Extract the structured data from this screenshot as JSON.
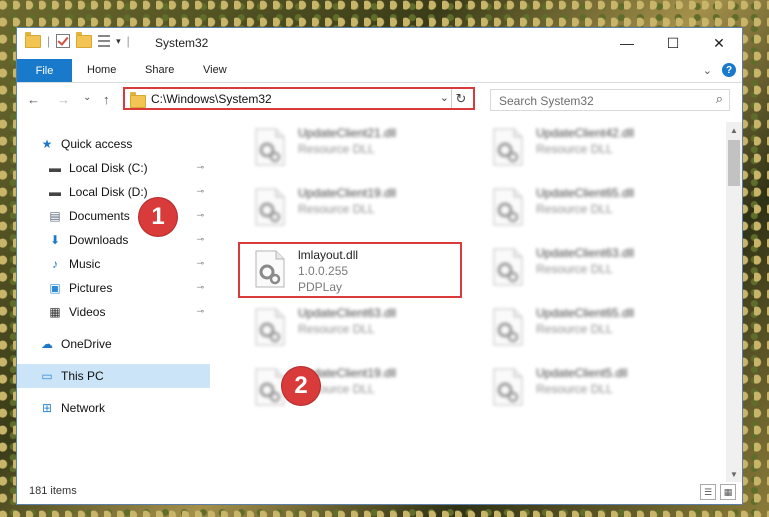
{
  "window": {
    "title": "System32",
    "caption_buttons": {
      "minimize": "—",
      "maximize": "☐",
      "close": "✕"
    }
  },
  "ribbon": {
    "file_tab": "File",
    "tabs": [
      "Home",
      "Share",
      "View"
    ],
    "expand_glyph": "⌄",
    "help_glyph": "?"
  },
  "navigation": {
    "back_glyph": "←",
    "forward_glyph": "→",
    "recent_glyph": "⌄",
    "up_glyph": "↑",
    "address": "C:\\Windows\\System32",
    "address_caret": "⌄",
    "refresh_glyph": "↻",
    "search_placeholder": "Search System32",
    "search_glyph": "⌕"
  },
  "sidebar": {
    "items": [
      {
        "label": "Quick access",
        "icon": "star-icon",
        "glyph": "★",
        "color": "#1e78c8",
        "pinned": false
      },
      {
        "label": "Local Disk (C:)",
        "icon": "drive-icon",
        "glyph": "▬",
        "color": "#444444",
        "pinned": true
      },
      {
        "label": "Local Disk (D:)",
        "icon": "drive-icon",
        "glyph": "▬",
        "color": "#444444",
        "pinned": true
      },
      {
        "label": "Documents",
        "icon": "document-icon",
        "glyph": "▤",
        "color": "#5a6b80",
        "pinned": true
      },
      {
        "label": "Downloads",
        "icon": "download-icon",
        "glyph": "⬇",
        "color": "#1e78c8",
        "pinned": true
      },
      {
        "label": "Music",
        "icon": "music-icon",
        "glyph": "♪",
        "color": "#1e78c8",
        "pinned": true
      },
      {
        "label": "Pictures",
        "icon": "pictures-icon",
        "glyph": "▣",
        "color": "#2e8bd8",
        "pinned": true
      },
      {
        "label": "Videos",
        "icon": "video-icon",
        "glyph": "▦",
        "color": "#333333",
        "pinned": true
      },
      {
        "label": "OneDrive",
        "icon": "cloud-icon",
        "glyph": "☁",
        "color": "#1e78c8",
        "pinned": false
      },
      {
        "label": "This PC",
        "icon": "computer-icon",
        "glyph": "▭",
        "color": "#2e8bd8",
        "pinned": false,
        "selected": true
      },
      {
        "label": "Network",
        "icon": "network-icon",
        "glyph": "⊞",
        "color": "#2e8bd8",
        "pinned": false
      }
    ],
    "pin_glyph": "📌"
  },
  "files": [
    {
      "name": "UpdateClient21.dll",
      "desc": "Resource DLL",
      "blurred": true
    },
    {
      "name": "UpdateClient42.dll",
      "desc": "Resource DLL",
      "blurred": true
    },
    {
      "name": "UpdateClient19.dll",
      "desc": "Resource DLL",
      "blurred": true
    },
    {
      "name": "UpdateClient65.dll",
      "desc": "Resource DLL",
      "blurred": true
    },
    {
      "name": "lmlayout.dll",
      "desc": "1.0.0.255",
      "desc2": "PDPLay",
      "blurred": false,
      "highlighted": true
    },
    {
      "name": "UpdateClient63.dll",
      "desc": "Resource DLL",
      "blurred": true
    },
    {
      "name": "UpdateClient63.dll",
      "desc": "Resource DLL",
      "blurred": true
    },
    {
      "name": "UpdateClient65.dll",
      "desc": "Resource DLL",
      "blurred": true
    },
    {
      "name": "UpdateClient19.dll",
      "desc": "Resource DLL",
      "blurred": true
    },
    {
      "name": "UpdateClient5.dll",
      "desc": "Resource DLL",
      "blurred": true
    }
  ],
  "status": {
    "item_count": "181 items"
  },
  "annotations": {
    "step1": "1",
    "step2": "2",
    "color": "#d93a3a"
  }
}
